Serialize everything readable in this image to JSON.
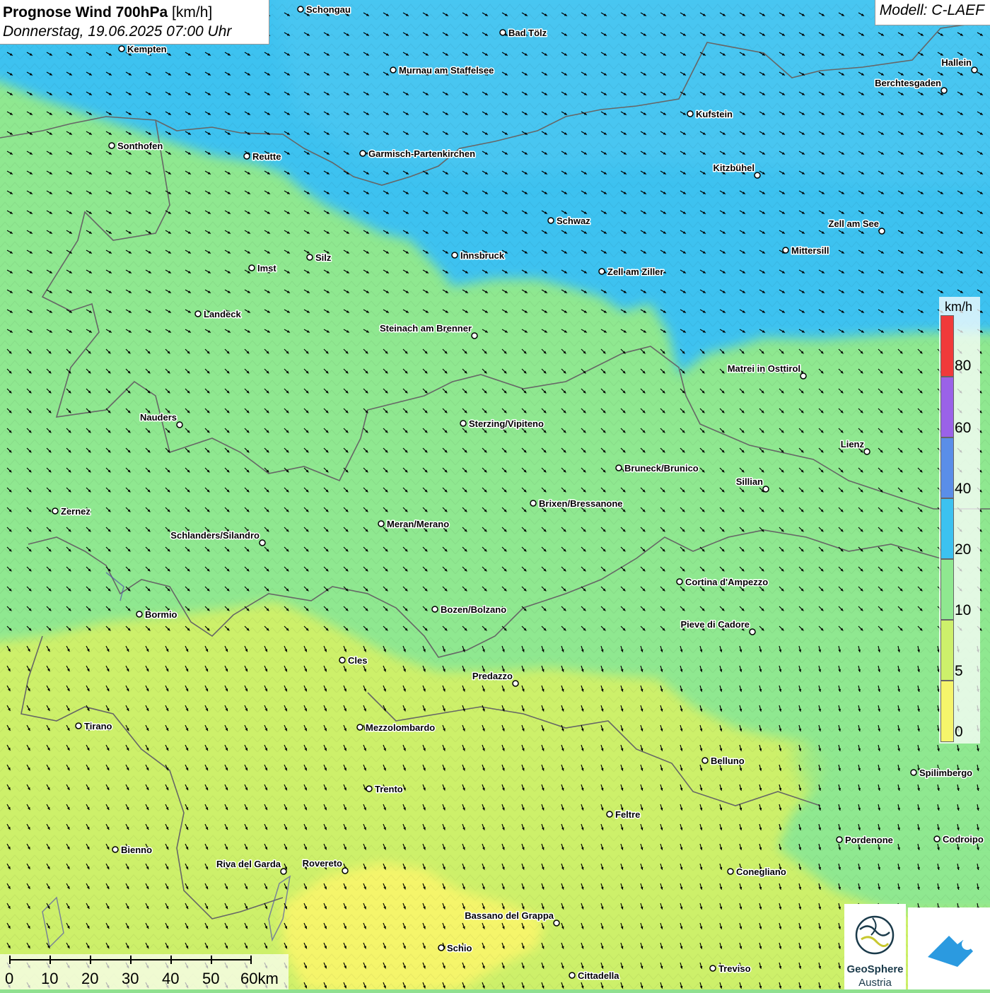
{
  "title": {
    "main_bold": "Prognose Wind 700hPa",
    "unit": "[km/h]",
    "date": "Donnerstag, 19.06.2025 07:00 Uhr"
  },
  "model_label": "Modell: C-LAEF",
  "legend": {
    "unit": "km/h",
    "labels": [
      "80",
      "60",
      "40",
      "20",
      "10",
      "5",
      "0"
    ],
    "colors": {
      "0": "#f5f56b",
      "5": "#cdf06b",
      "10": "#8fe890",
      "20": "#3cc2f0",
      "40": "#5a8ee8",
      "60": "#9a62e8",
      "80": "#f03a3a",
      "above": "#c0ecf8"
    }
  },
  "scale_bar": {
    "labels": [
      "0",
      "10",
      "20",
      "30",
      "40",
      "50",
      "60km"
    ]
  },
  "cities": [
    {
      "name": "Schongau"
    },
    {
      "name": "Bad Tölz"
    },
    {
      "name": "Kempten"
    },
    {
      "name": "Murnau am Staffelsee"
    },
    {
      "name": "Hallein"
    },
    {
      "name": "Berchtesgaden"
    },
    {
      "name": "Kufstein"
    },
    {
      "name": "Sonthofen"
    },
    {
      "name": "Reutte"
    },
    {
      "name": "Garmisch-Partenkirchen"
    },
    {
      "name": "Kitzbühel"
    },
    {
      "name": "Schwaz"
    },
    {
      "name": "Zell am See"
    },
    {
      "name": "Mittersill"
    },
    {
      "name": "Silz"
    },
    {
      "name": "Innsbruck"
    },
    {
      "name": "Imst"
    },
    {
      "name": "Zell am Ziller"
    },
    {
      "name": "Landeck"
    },
    {
      "name": "Steinach am Brenner"
    },
    {
      "name": "Matrei in Osttirol"
    },
    {
      "name": "Nauders"
    },
    {
      "name": "Sterzing/Vipiteno"
    },
    {
      "name": "Lienz"
    },
    {
      "name": "Bruneck/Brunico"
    },
    {
      "name": "Sillian"
    },
    {
      "name": "Zernez"
    },
    {
      "name": "Brixen/Bressanone"
    },
    {
      "name": "Meran/Merano"
    },
    {
      "name": "Schlanders/Silandro"
    },
    {
      "name": "Cortina d'Ampezzo"
    },
    {
      "name": "Bozen/Bolzano"
    },
    {
      "name": "Bormio"
    },
    {
      "name": "Pieve di Cadore"
    },
    {
      "name": "Cles"
    },
    {
      "name": "Predazzo"
    },
    {
      "name": "Tirano"
    },
    {
      "name": "Mezzolombardo"
    },
    {
      "name": "Belluno"
    },
    {
      "name": "Spilimbergo"
    },
    {
      "name": "Trento"
    },
    {
      "name": "Feltre"
    },
    {
      "name": "Pordenone"
    },
    {
      "name": "Codroipo"
    },
    {
      "name": "Bienno"
    },
    {
      "name": "Riva del Garda"
    },
    {
      "name": "Rovereto"
    },
    {
      "name": "Conegliano"
    },
    {
      "name": "Bassano del Grappa"
    },
    {
      "name": "Schio"
    },
    {
      "name": "Treviso"
    },
    {
      "name": "Cittadella"
    }
  ],
  "logos": {
    "geosphere_line1": "GeoSphere",
    "geosphere_line2": "Austria"
  }
}
